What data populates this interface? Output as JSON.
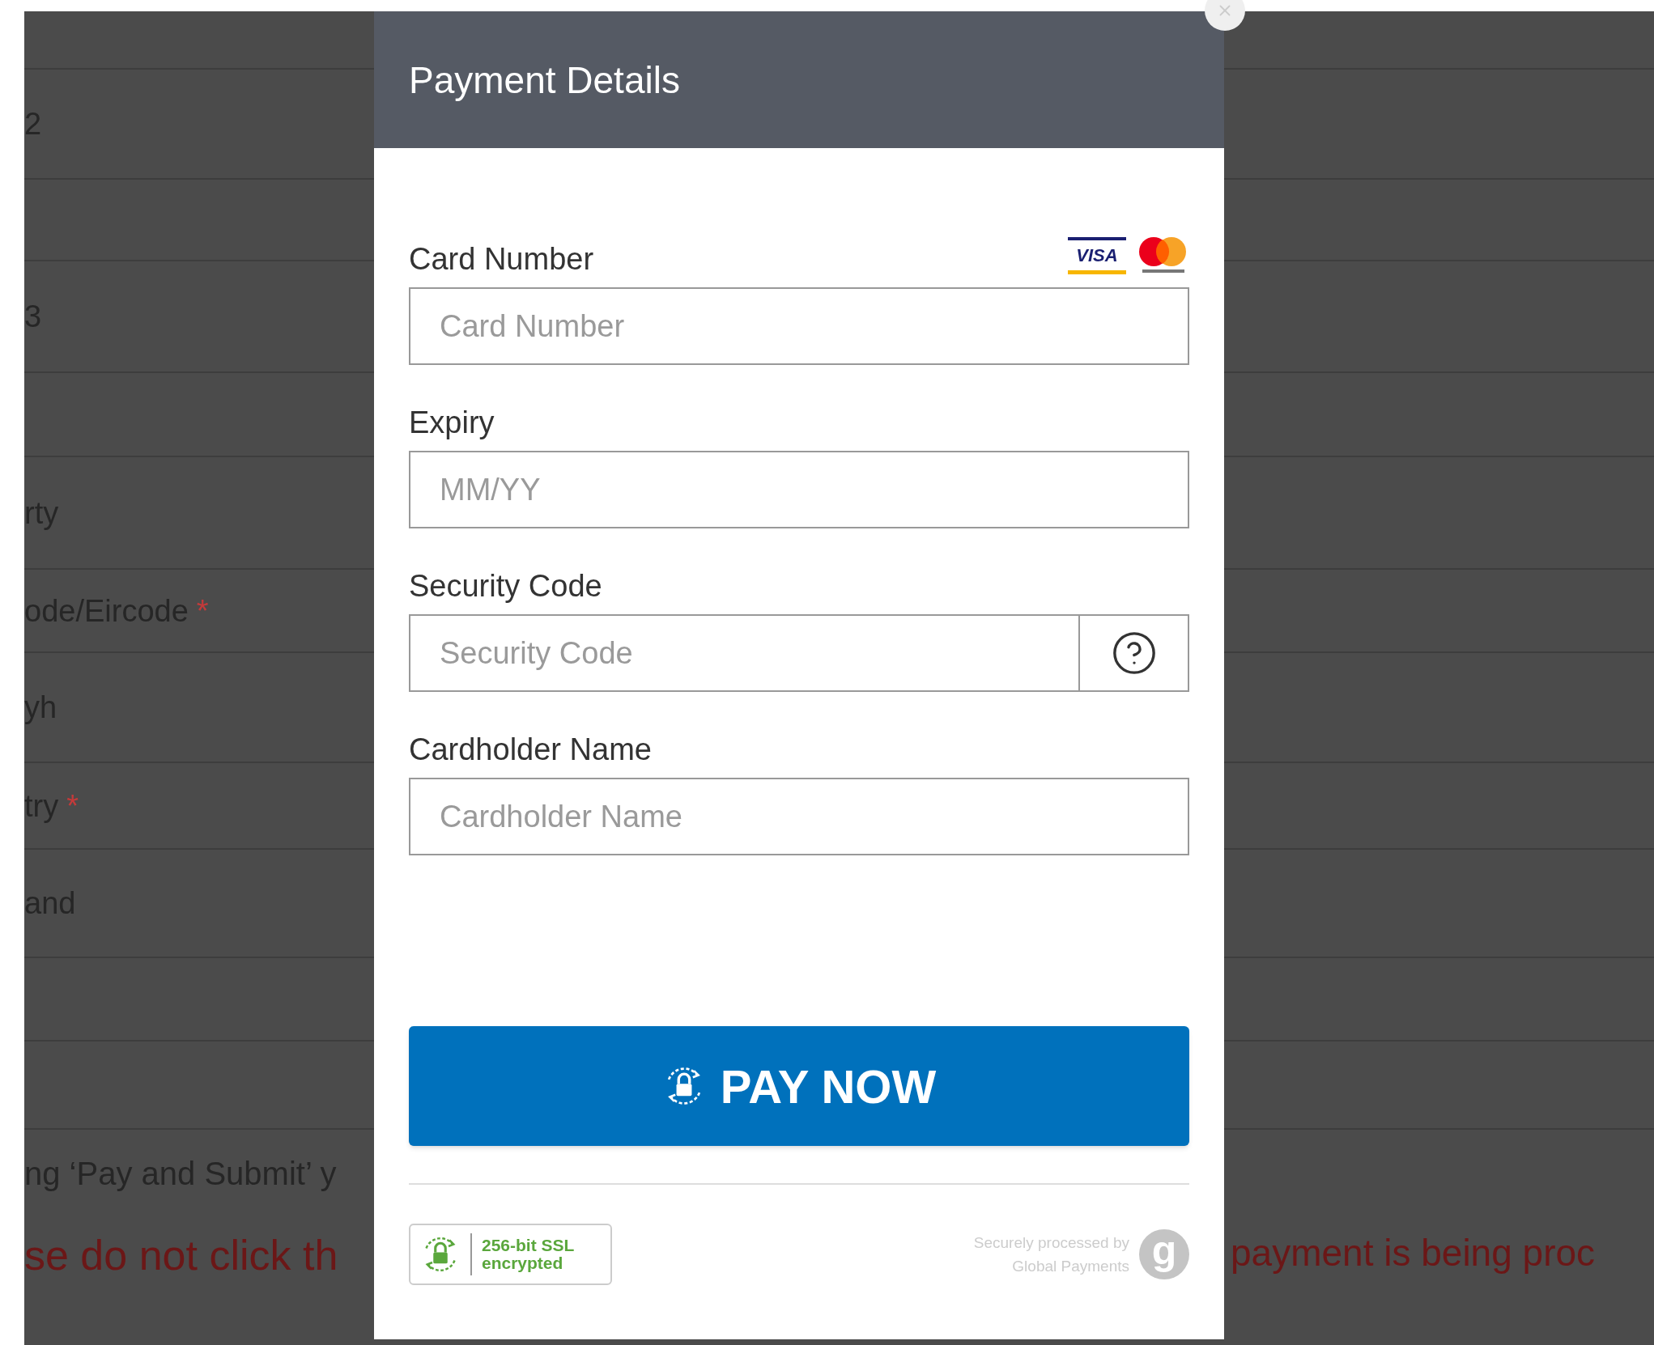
{
  "background_form": {
    "rows": [
      {},
      {
        "text": "2",
        "required": false
      },
      {},
      {
        "text": "3",
        "required": false
      },
      {},
      {
        "text": "rty",
        "required": false
      },
      {
        "text": "ode/Eircode",
        "required": true
      },
      {
        "text": "yh",
        "required": false
      },
      {
        "text": "try",
        "required": true
      },
      {
        "text": "and",
        "required": false
      },
      {},
      {}
    ],
    "required_mark": "*",
    "note": "ng ‘Pay and Submit’ y",
    "warning_left": "se do not click th",
    "warning_right": "payment is being proc"
  },
  "modal": {
    "title": "Payment Details",
    "card_brands": [
      {
        "kind": "visa",
        "text": "VISA"
      },
      {
        "kind": "mastercard"
      }
    ],
    "fields": [
      {
        "label": "Card Number",
        "placeholder": "Card Number",
        "kind": "text"
      },
      {
        "label": "Expiry",
        "placeholder": "MM/YY",
        "kind": "text"
      },
      {
        "label": "Security Code",
        "placeholder": "Security Code",
        "kind": "help"
      },
      {
        "label": "Cardholder Name",
        "placeholder": "Cardholder Name",
        "kind": "text"
      }
    ],
    "pay_button": "PAY NOW",
    "ssl_badge": [
      "256-bit SSL",
      "encrypted"
    ],
    "processor": {
      "lines": [
        "Securely processed by",
        "Global Payments"
      ],
      "logo_text": "g"
    }
  }
}
